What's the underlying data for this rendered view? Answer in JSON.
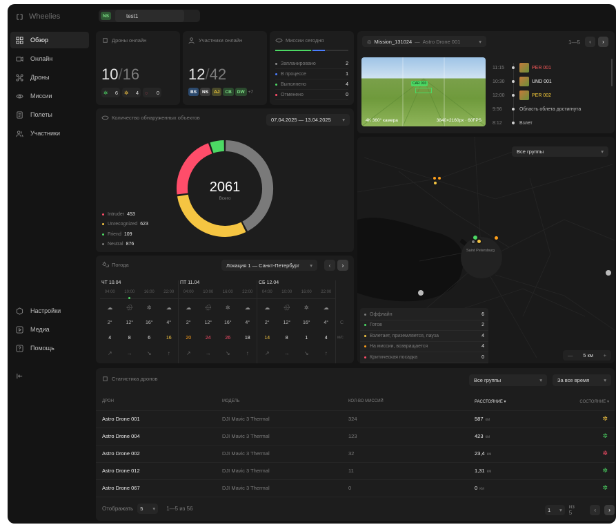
{
  "app": {
    "name": "Wheelies"
  },
  "topbar": {
    "user_initials": "NS",
    "workspace": "test1"
  },
  "sidebar": {
    "items": [
      {
        "label": "Обзор"
      },
      {
        "label": "Онлайн"
      },
      {
        "label": "Дроны"
      },
      {
        "label": "Миссии"
      },
      {
        "label": "Полеты"
      },
      {
        "label": "Участники"
      }
    ],
    "bottom": [
      {
        "label": "Настройки"
      },
      {
        "label": "Медиа"
      },
      {
        "label": "Помощь"
      }
    ]
  },
  "drones_online": {
    "title": "Дроны онлайн",
    "current": "10",
    "total": "16",
    "stats": [
      "6",
      "4",
      "0"
    ]
  },
  "members_online": {
    "title": "Участники онлайн",
    "current": "12",
    "total": "42",
    "avatars": [
      "BS",
      "NS",
      "AJ",
      "CB",
      "DW"
    ],
    "more": "+7"
  },
  "missions_today": {
    "title": "Миссии сегодня",
    "items": [
      {
        "label": "Запланировано",
        "value": "2",
        "color": "#8a8a8a"
      },
      {
        "label": "В процессе",
        "value": "1",
        "color": "#4a7dff"
      },
      {
        "label": "Выполнено",
        "value": "4",
        "color": "#4cd964"
      },
      {
        "label": "Отменено",
        "value": "0",
        "color": "#ff4d6a"
      }
    ]
  },
  "detected": {
    "title": "Количество обнаруженных объектов",
    "date_range": "07.04.2025 — 13.04.2025",
    "total": "2061",
    "total_label": "Всего",
    "legend": [
      {
        "label": "Intruder",
        "value": "453",
        "color": "#ff4d6a"
      },
      {
        "label": "Unrecognized",
        "value": "623",
        "color": "#f5c542"
      },
      {
        "label": "Friend",
        "value": "109",
        "color": "#4cd964"
      },
      {
        "label": "Neutral",
        "value": "876",
        "color": "#7a7a7a"
      }
    ]
  },
  "mission": {
    "name": "Mission_131024",
    "drone": "Astro Drone 001",
    "pager": "1—5",
    "overlay_left": "4K 360° камера",
    "overlay_right": "3840×2160px · 60FPS",
    "target_tag": "CAR 003",
    "events": [
      {
        "time": "11:15",
        "label": "PER 001",
        "color": "#ff5a5a",
        "thumb": true
      },
      {
        "time": "10:30",
        "label": "UND 001",
        "color": "#f0f0f0",
        "thumb": true
      },
      {
        "time": "12:00",
        "label": "PER 002",
        "color": "#ffd23a",
        "thumb": true
      },
      {
        "time": "9:56",
        "label": "Область облета достигнута",
        "color": "#bdbdbd",
        "thumb": false
      },
      {
        "time": "8:12",
        "label": "Взлет",
        "color": "#bdbdbd",
        "thumb": false
      }
    ]
  },
  "map": {
    "group_select": "Все группы",
    "city": "Saint Petersburg",
    "scale": "5 км",
    "legend": [
      {
        "label": "Оффлайн",
        "value": "6",
        "color": "#7a7a7a"
      },
      {
        "label": "Готов",
        "value": "2",
        "color": "#4cd964"
      },
      {
        "label": "Взлетает, приземляется, пауза",
        "value": "4",
        "color": "#f5c542"
      },
      {
        "label": "На миссии, возвращается",
        "value": "4",
        "color": "#ff9f1a"
      },
      {
        "label": "Критическая посадка",
        "value": "0",
        "color": "#ff4d6a"
      }
    ]
  },
  "weather": {
    "title": "Погода",
    "location": "Локация 1 — Санкт-Петербург",
    "days": [
      {
        "label": "ЧТ 10.04",
        "hours": [
          "04:00",
          "10:00",
          "16:00",
          "22:00"
        ],
        "temps": [
          "2°",
          "12°",
          "16°",
          "4°"
        ],
        "wind": [
          "4",
          "8",
          "6",
          "16"
        ],
        "wind_colors": [
          "#e6e6e6",
          "#e6e6e6",
          "#e6e6e6",
          "#f5c542"
        ]
      },
      {
        "label": "ПТ 11.04",
        "hours": [
          "04:00",
          "10:00",
          "16:00",
          "22:00"
        ],
        "temps": [
          "2°",
          "12°",
          "16°",
          "4°"
        ],
        "wind": [
          "20",
          "24",
          "26",
          "18"
        ],
        "wind_colors": [
          "#ff9f1a",
          "#ff4d6a",
          "#ff4d6a",
          "#e6e6e6"
        ]
      },
      {
        "label": "СБ 12.04",
        "hours": [
          "04:00",
          "10:00",
          "16:00",
          "22:00"
        ],
        "temps": [
          "2°",
          "12°",
          "16°",
          "4°"
        ],
        "wind": [
          "14",
          "8",
          "1",
          "4"
        ],
        "wind_colors": [
          "#f5c542",
          "#e6e6e6",
          "#e6e6e6",
          "#e6e6e6"
        ]
      }
    ],
    "unit_temp": "C",
    "unit_wind": "м/с"
  },
  "stats": {
    "title": "Статистика дронов",
    "group_select": "Все группы",
    "period_select": "За все время",
    "columns": [
      "ДРОН",
      "МОДЕЛЬ",
      "КОЛ-ВО МИССИЙ",
      "РАССТОЯНИЕ",
      "СОСТОЯНИЕ"
    ],
    "rows": [
      {
        "name": "Astro Drone 001",
        "model": "DJI Mavic 3 Thermal",
        "missions": "324",
        "dist": "587",
        "unit": "км",
        "status": "#f5c542"
      },
      {
        "name": "Astro Drone 004",
        "model": "DJI Mavic 3 Thermal",
        "missions": "123",
        "dist": "423",
        "unit": "км",
        "status": "#4cd964"
      },
      {
        "name": "Astro Drone 002",
        "model": "DJI Mavic 3 Thermal",
        "missions": "32",
        "dist": "23,4",
        "unit": "км",
        "status": "#ff4d6a"
      },
      {
        "name": "Astro Drone 012",
        "model": "DJI Mavic 3 Thermal",
        "missions": "11",
        "dist": "1,31",
        "unit": "км",
        "status": "#4cd964"
      },
      {
        "name": "Astro Drone 067",
        "model": "DJI Mavic 3 Thermal",
        "missions": "0",
        "dist": "0",
        "unit": "км",
        "status": "#4cd964"
      }
    ],
    "show_label": "Отображать",
    "per_page": "5",
    "range": "1—5 из 56",
    "page": "1",
    "of": "из 5"
  }
}
